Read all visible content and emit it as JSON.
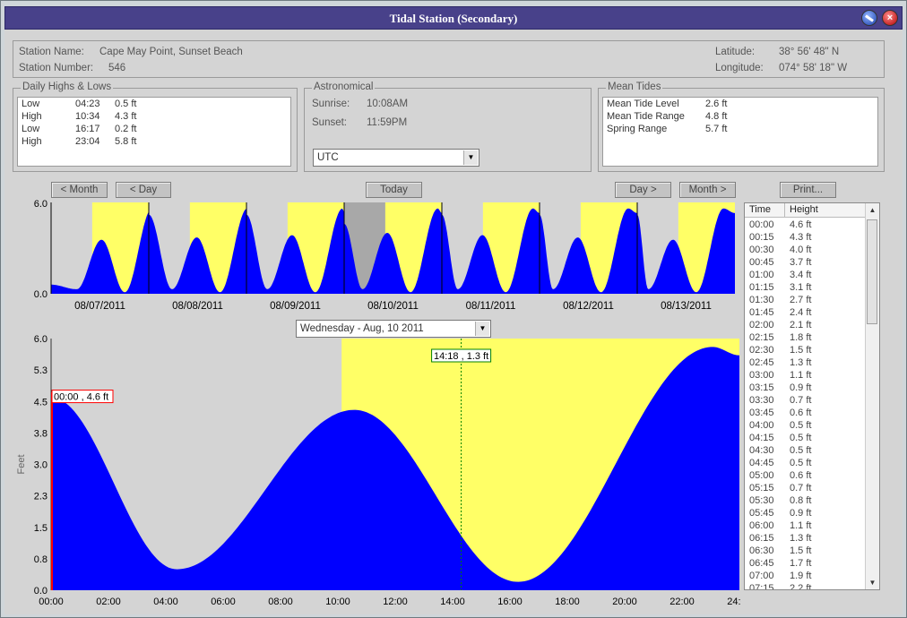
{
  "window": {
    "title": "Tidal Station (Secondary)"
  },
  "station": {
    "name_label": "Station Name:",
    "name": "Cape May Point, Sunset Beach",
    "number_label": "Station Number:",
    "number": "546",
    "lat_label": "Latitude:",
    "lat": "38° 56' 48\" N",
    "lon_label": "Longitude:",
    "lon": "074° 58' 18\" W"
  },
  "daily": {
    "title": "Daily Highs & Lows",
    "rows": [
      {
        "type": "Low",
        "time": "04:23",
        "height": "0.5 ft"
      },
      {
        "type": "High",
        "time": "10:34",
        "height": "4.3 ft"
      },
      {
        "type": "Low",
        "time": "16:17",
        "height": "0.2 ft"
      },
      {
        "type": "High",
        "time": "23:04",
        "height": "5.8 ft"
      }
    ]
  },
  "astro": {
    "title": "Astronomical",
    "sunrise_label": "Sunrise:",
    "sunrise": "10:08AM",
    "sunset_label": "Sunset:",
    "sunset": "11:59PM",
    "timezone": "UTC"
  },
  "mean": {
    "title": "Mean Tides",
    "rows": [
      {
        "label": "Mean Tide Level",
        "value": "2.6 ft"
      },
      {
        "label": "Mean Tide Range",
        "value": "4.8 ft"
      },
      {
        "label": "Spring Range",
        "value": "5.7 ft"
      }
    ]
  },
  "nav": {
    "prev_month": "< Month",
    "prev_day": "< Day",
    "today": "Today",
    "next_day": "Day >",
    "next_month": "Month >",
    "print": "Print..."
  },
  "week_chart": {
    "ymax_label": "6.0",
    "ymin_label": "0.0",
    "dates": [
      "08/07/2011",
      "08/08/2011",
      "08/09/2011",
      "08/10/2011",
      "08/11/2011",
      "08/12/2011",
      "08/13/2011"
    ],
    "selected_index": 3
  },
  "day_select": "Wednesday - Aug, 10 2011",
  "chart_data": {
    "type": "area",
    "ylabel": "Feet",
    "ylim": [
      0,
      6
    ],
    "yticks": [
      "0.0",
      "0.8",
      "1.5",
      "2.3",
      "3.0",
      "3.8",
      "4.5",
      "5.3",
      "6.0"
    ],
    "xticks": [
      "00:00",
      "02:00",
      "04:00",
      "06:00",
      "08:00",
      "10:00",
      "12:00",
      "14:00",
      "16:00",
      "18:00",
      "20:00",
      "22:00",
      "24:00"
    ],
    "daylight_start_hour": 10.13,
    "cursor": {
      "hour": 14.3,
      "label": "14:18 , 1.3 ft"
    },
    "start_marker": {
      "label": "00:00 , 4.6 ft"
    },
    "extremes": [
      {
        "hour": 0,
        "height": 4.6
      },
      {
        "hour": 4.38,
        "height": 0.5
      },
      {
        "hour": 10.57,
        "height": 4.3
      },
      {
        "hour": 16.28,
        "height": 0.2
      },
      {
        "hour": 23.07,
        "height": 5.8
      },
      {
        "hour": 24,
        "height": 5.6
      }
    ],
    "colors": {
      "water": "#0000ff",
      "day": "#ffff66",
      "night": "#d4d4d4",
      "cursor": "#008000",
      "marker": "#ff0000"
    }
  },
  "table": {
    "headers": [
      "Time",
      "Height"
    ],
    "rows": [
      [
        "00:00",
        "4.6 ft"
      ],
      [
        "00:15",
        "4.3 ft"
      ],
      [
        "00:30",
        "4.0 ft"
      ],
      [
        "00:45",
        "3.7 ft"
      ],
      [
        "01:00",
        "3.4 ft"
      ],
      [
        "01:15",
        "3.1 ft"
      ],
      [
        "01:30",
        "2.7 ft"
      ],
      [
        "01:45",
        "2.4 ft"
      ],
      [
        "02:00",
        "2.1 ft"
      ],
      [
        "02:15",
        "1.8 ft"
      ],
      [
        "02:30",
        "1.5 ft"
      ],
      [
        "02:45",
        "1.3 ft"
      ],
      [
        "03:00",
        "1.1 ft"
      ],
      [
        "03:15",
        "0.9 ft"
      ],
      [
        "03:30",
        "0.7 ft"
      ],
      [
        "03:45",
        "0.6 ft"
      ],
      [
        "04:00",
        "0.5 ft"
      ],
      [
        "04:15",
        "0.5 ft"
      ],
      [
        "04:30",
        "0.5 ft"
      ],
      [
        "04:45",
        "0.5 ft"
      ],
      [
        "05:00",
        "0.6 ft"
      ],
      [
        "05:15",
        "0.7 ft"
      ],
      [
        "05:30",
        "0.8 ft"
      ],
      [
        "05:45",
        "0.9 ft"
      ],
      [
        "06:00",
        "1.1 ft"
      ],
      [
        "06:15",
        "1.3 ft"
      ],
      [
        "06:30",
        "1.5 ft"
      ],
      [
        "06:45",
        "1.7 ft"
      ],
      [
        "07:00",
        "1.9 ft"
      ],
      [
        "07:15",
        "2.2 ft"
      ]
    ]
  }
}
